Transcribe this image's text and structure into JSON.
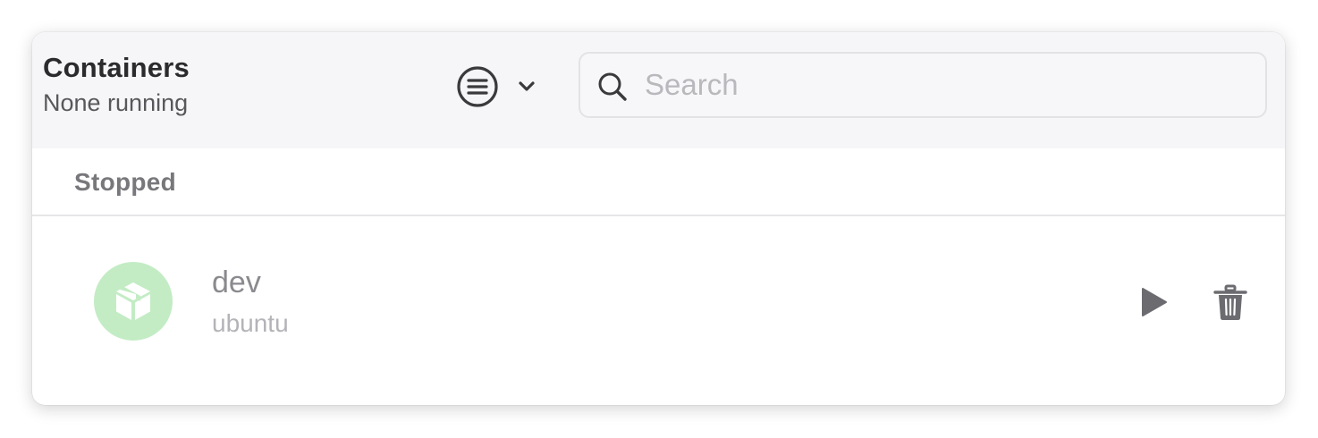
{
  "header": {
    "title": "Containers",
    "subtitle": "None running"
  },
  "toolbar": {
    "view_menu_icon": "list-circle-icon",
    "view_menu_chevron": "chevron-down-icon"
  },
  "search": {
    "placeholder": "Search",
    "value": ""
  },
  "sections": [
    {
      "label": "Stopped",
      "items": [
        {
          "name": "dev",
          "image": "ubuntu",
          "icon": "package-icon",
          "icon_bg_color": "#c3ecc5",
          "actions": [
            "play-icon",
            "trash-icon"
          ]
        }
      ]
    }
  ],
  "colors": {
    "toolbar_bg": "#f6f6f8",
    "accent_green": "#c3ecc5",
    "action_gray": "#6b6b70"
  }
}
